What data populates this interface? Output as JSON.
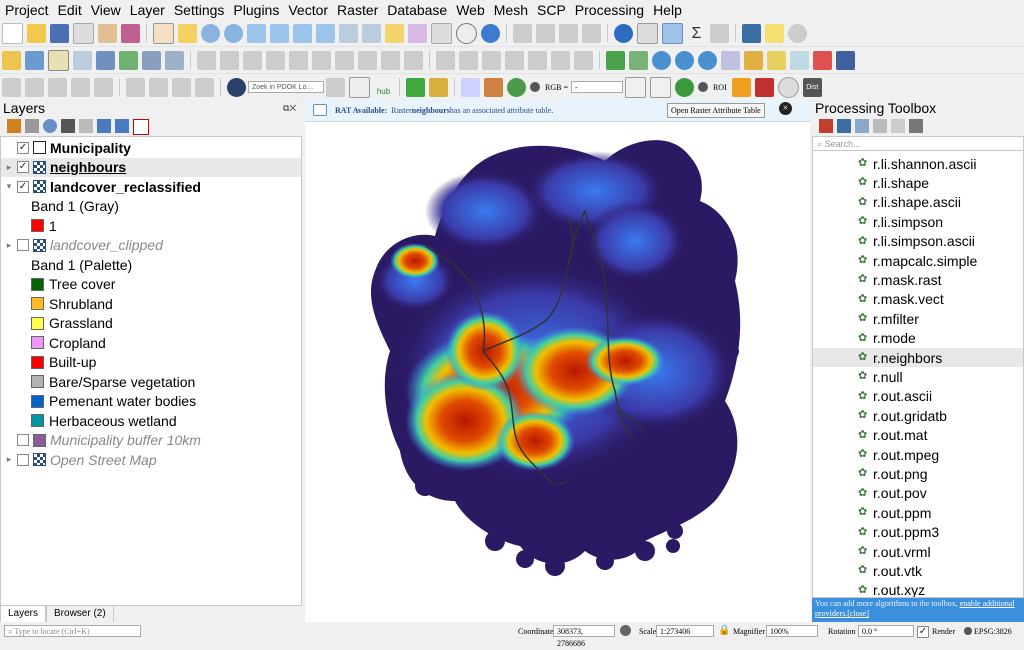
{
  "menubar": [
    "Project",
    "Edit",
    "View",
    "Layer",
    "Settings",
    "Plugins",
    "Vector",
    "Raster",
    "Database",
    "Web",
    "Mesh",
    "SCP",
    "Processing",
    "Help"
  ],
  "toolbar": {
    "pdok_search_placeholder": "Zoek in PDOK Lo…",
    "hub_label": "hub",
    "rgb_label": "RGB =",
    "rgb_value": "-",
    "roi_label": "ROI",
    "dist_label": "Dist"
  },
  "layers_panel": {
    "title": "Layers",
    "items": [
      {
        "label": "Municipality",
        "checked": true,
        "style": "bold",
        "kind": "vector"
      },
      {
        "label": "neighbours",
        "checked": true,
        "style": "bold-underline",
        "kind": "raster",
        "selected": true
      },
      {
        "label": "landcover_reclassified",
        "checked": true,
        "style": "bold",
        "kind": "raster"
      },
      {
        "label": "Band 1 (Gray)",
        "kind": "legend-header"
      },
      {
        "label": "1",
        "kind": "legend",
        "color": "#ff0000"
      },
      {
        "label": "landcover_clipped",
        "checked": false,
        "style": "italic",
        "kind": "raster"
      },
      {
        "label": "Band 1 (Palette)",
        "kind": "legend-header"
      },
      {
        "label": "Tree cover",
        "kind": "legend",
        "color": "#006400"
      },
      {
        "label": "Shrubland",
        "kind": "legend",
        "color": "#ffbb22"
      },
      {
        "label": "Grassland",
        "kind": "legend",
        "color": "#ffff4c"
      },
      {
        "label": "Cropland",
        "kind": "legend",
        "color": "#f096ff"
      },
      {
        "label": "Built-up",
        "kind": "legend",
        "color": "#fa0000"
      },
      {
        "label": "Bare/Sparse vegetation",
        "kind": "legend",
        "color": "#b4b4b4"
      },
      {
        "label": "Pemenant water bodies",
        "kind": "legend",
        "color": "#0064c8"
      },
      {
        "label": "Herbaceous wetland",
        "kind": "legend",
        "color": "#0096a0"
      },
      {
        "label": "Municipality buffer 10km",
        "checked": false,
        "style": "italic",
        "kind": "vector-fill",
        "color": "#8e5b9a"
      },
      {
        "label": "Open Street Map",
        "checked": false,
        "style": "italic",
        "kind": "raster"
      }
    ],
    "tabs": [
      "Layers",
      "Browser (2)"
    ]
  },
  "rat_bar": {
    "prefix": "RAT Available:",
    "text1": "Raster ",
    "layer": "neighbours",
    "text2": " has an associated attribute table.",
    "button": "Open Raster Attribute Table",
    "close": "×"
  },
  "processing": {
    "title": "Processing Toolbox",
    "search_placeholder": "Search...",
    "algorithms": [
      "r.li.shannon.ascii",
      "r.li.shape",
      "r.li.shape.ascii",
      "r.li.simpson",
      "r.li.simpson.ascii",
      "r.mapcalc.simple",
      "r.mask.rast",
      "r.mask.vect",
      "r.mfilter",
      "r.mode",
      "r.neighbors",
      "r.null",
      "r.out.ascii",
      "r.out.gridatb",
      "r.out.mat",
      "r.out.mpeg",
      "r.out.png",
      "r.out.pov",
      "r.out.ppm",
      "r.out.ppm3",
      "r.out.vrml",
      "r.out.vtk",
      "r.out.xyz"
    ],
    "selected": "r.neighbors",
    "info_text": "You can add more algorithms to the toolbox, ",
    "info_link": "enable additional providers.",
    "info_close": "[close]"
  },
  "statusbar": {
    "locate_placeholder": "Type to locate (Ctrl+K)",
    "coordinate_label": "Coordinate",
    "coordinate_value": "308373, 2786686",
    "scale_label": "Scale",
    "scale_value": "1:273406",
    "magnifier_label": "Magnifier",
    "magnifier_value": "100%",
    "rotation_label": "Rotation",
    "rotation_value": "0.0 °",
    "render_label": "Render",
    "crs": "EPSG:3826"
  },
  "colors": {
    "info_blue": "#3c8fdd",
    "rat_bg": "#e9f3fb",
    "heat_low": "#2b1a63",
    "heat_mid": "#3a7bf0",
    "heat_high": "#c01e00"
  }
}
